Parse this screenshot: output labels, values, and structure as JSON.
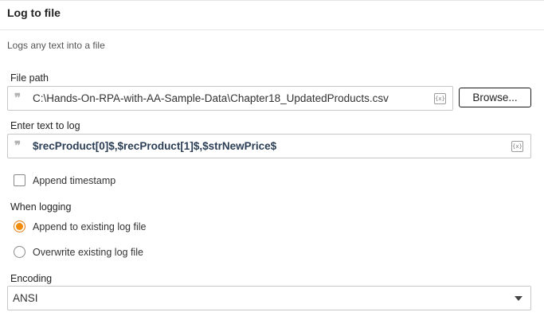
{
  "panel": {
    "title": "Log to file",
    "description": "Logs any text into a file"
  },
  "file_path": {
    "label": "File path",
    "value": "C:\\Hands-On-RPA-with-AA-Sample-Data\\Chapter18_UpdatedProducts.csv",
    "quote_glyph": "❞",
    "variable_icon": "{x}",
    "browse_label": "Browse..."
  },
  "log_text": {
    "label": "Enter text to log",
    "value": "$recProduct[0]$,$recProduct[1]$,$strNewPrice$",
    "quote_glyph": "❞",
    "variable_icon": "{x}"
  },
  "append_timestamp": {
    "label": "Append timestamp",
    "checked": false
  },
  "when_logging": {
    "label": "When logging",
    "options": [
      {
        "label": "Append to existing log file",
        "selected": true
      },
      {
        "label": "Overwrite existing log file",
        "selected": false
      }
    ]
  },
  "encoding": {
    "label": "Encoding",
    "selected": "ANSI"
  },
  "colors": {
    "accent": "#f28a0a",
    "variable_text": "#2b3e55"
  }
}
